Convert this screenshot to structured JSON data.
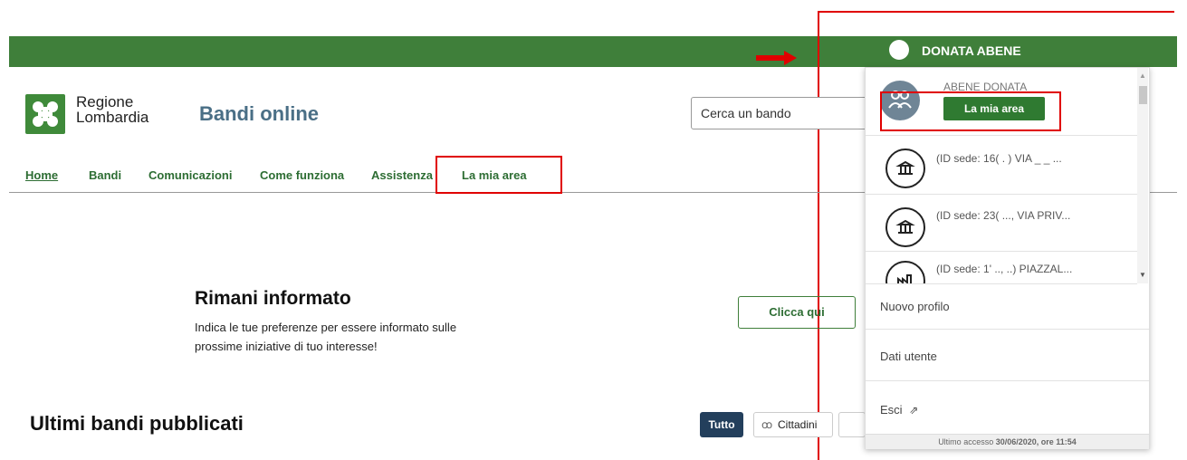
{
  "header": {
    "user_name": "DONATA ABENE",
    "logo_line1": "Regione",
    "logo_line2": "Lombardia",
    "site_title": "Bandi online",
    "search_placeholder": "Cerca un bando"
  },
  "nav": {
    "items": [
      "Home",
      "Bandi",
      "Comunicazioni",
      "Come funziona",
      "Assistenza",
      "La mia area"
    ]
  },
  "rimani": {
    "title": "Rimani informato",
    "text": "Indica le tue preferenze per essere informato sulle prossime iniziative di tuo interesse!",
    "button": "Clicca qui"
  },
  "ultimi": {
    "title": "Ultimi bandi pubblicati",
    "filters": [
      "Tutto",
      "Cittadini"
    ]
  },
  "dropdown": {
    "profile_name": "ABENE DONATA",
    "profile_button": "La mia area",
    "sedi": [
      "(ID sede: 16( . ) VIA _ _ ...",
      "(ID sede: 23( ..., VIA PRIV...",
      "(ID sede: 1' .., ..) PIAZZAL..."
    ],
    "menu": [
      "Nuovo profilo",
      "Dati utente",
      "Esci"
    ],
    "last_access_label": "Ultimo accesso",
    "last_access_value": "30/06/2020, ore 11:54"
  },
  "colors": {
    "brand_green": "#3f7f3a",
    "highlight_red": "#e00000"
  }
}
